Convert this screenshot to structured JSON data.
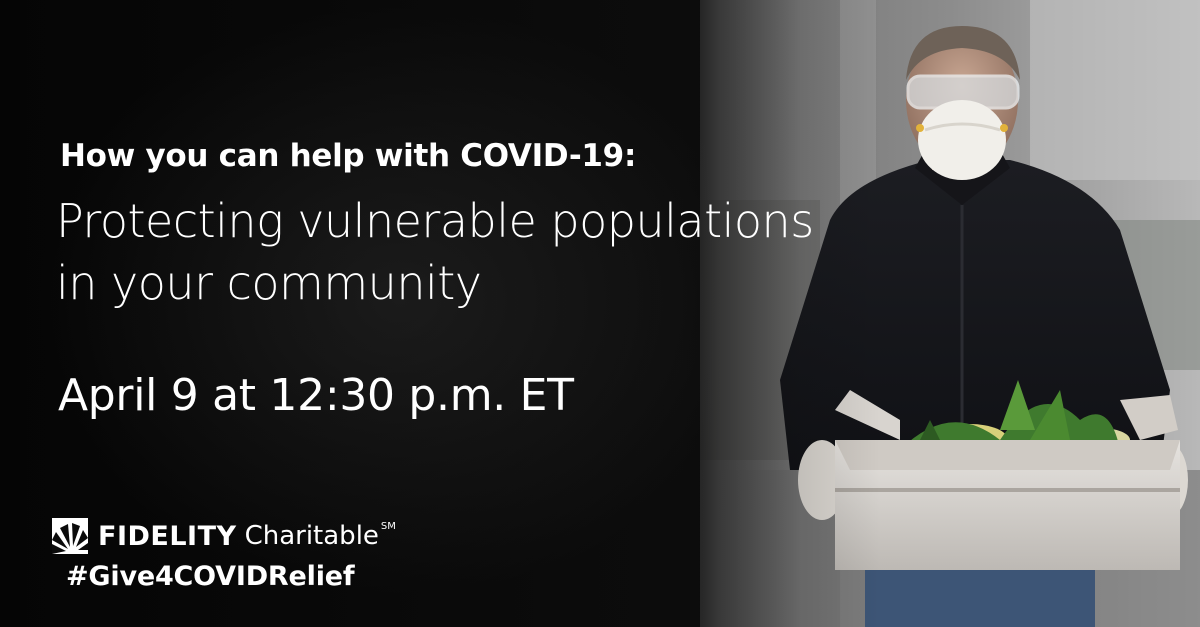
{
  "banner": {
    "eyebrow": "How you can help with COVID-19:",
    "headline_lines": [
      "Protecting vulnerable populations",
      "in your community"
    ],
    "date": "April 9 at 12:30 p.m. ET",
    "logo": {
      "name_bold": "FIDELITY",
      "name_light": "Charitable",
      "service_mark": "SM"
    },
    "hashtag": "#Give4COVIDRelief"
  },
  "photo": {
    "icon": "volunteer-with-produce-box-photo"
  },
  "colors": {
    "background": "#0a0a0a",
    "text": "#ffffff"
  }
}
